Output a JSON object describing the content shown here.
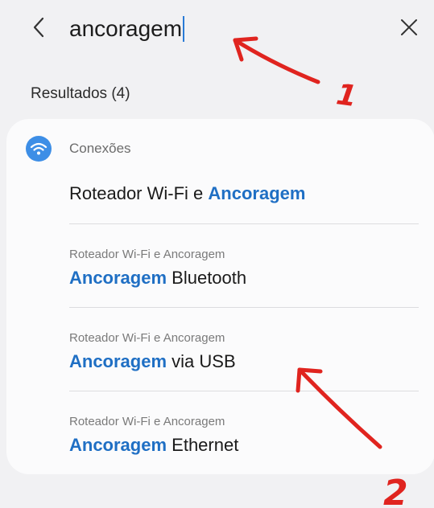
{
  "search": {
    "query": "ancoragem"
  },
  "results_header": "Resultados (4)",
  "category": {
    "label": "Conexões",
    "icon": "wifi-icon",
    "icon_color": "#3d8ee6"
  },
  "results": [
    {
      "subtitle": "",
      "title_prefix": "Roteador Wi-Fi e ",
      "highlight": "Ancoragem",
      "title_suffix": ""
    },
    {
      "subtitle": "Roteador Wi-Fi e Ancoragem",
      "title_prefix": "",
      "highlight": "Ancoragem",
      "title_suffix": " Bluetooth"
    },
    {
      "subtitle": "Roteador Wi-Fi e Ancoragem",
      "title_prefix": "",
      "highlight": "Ancoragem",
      "title_suffix": " via USB"
    },
    {
      "subtitle": "Roteador Wi-Fi e Ancoragem",
      "title_prefix": "",
      "highlight": "Ancoragem",
      "title_suffix": " Ethernet"
    }
  ],
  "annotations": {
    "marker_1": "1",
    "marker_2": "2",
    "color": "#e0241f"
  },
  "colors": {
    "highlight": "#1f6fc4",
    "caret": "#2a7bd6",
    "background": "#f1f1f3",
    "card": "#fbfbfc"
  }
}
